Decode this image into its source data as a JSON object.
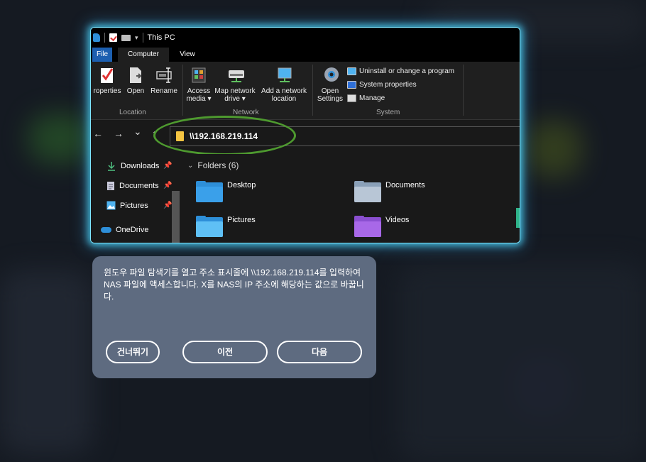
{
  "window": {
    "title": "This PC",
    "tabs": [
      "File",
      "Computer",
      "View"
    ],
    "ribbon": {
      "location": {
        "label": "Location",
        "buttons": [
          "roperties",
          "Open",
          "Rename"
        ]
      },
      "network": {
        "label": "Network",
        "buttons": [
          {
            "line1": "Access",
            "line2": "media ▾"
          },
          {
            "line1": "Map network",
            "line2": "drive ▾"
          },
          {
            "line1": "Add a network",
            "line2": "location"
          }
        ]
      },
      "system": {
        "label": "System",
        "open_settings_line1": "Open",
        "open_settings_line2": "Settings",
        "items": [
          "Uninstall or change a program",
          "System properties",
          "Manage"
        ]
      }
    },
    "nav": {
      "back": "←",
      "forward": "→",
      "recent": "⌄",
      "up": "↑"
    },
    "address": "\\\\192.168.219.114",
    "sidebar": {
      "items": [
        "Downloads",
        "Documents",
        "Pictures",
        "OneDrive"
      ]
    },
    "content": {
      "section": "Folders (6)",
      "folders": [
        "Desktop",
        "Documents",
        "Pictures",
        "Videos"
      ]
    }
  },
  "dialog": {
    "text": "윈도우 파일 탐색기를 열고 주소 표시줄에 \\\\192.168.219.114를 입력하여 NAS 파일에 액세스합니다. X를 NAS의 IP 주소에 해당하는 값으로 바꿉니다.",
    "skip_label": "건너뛰기",
    "prev_label": "이전",
    "next_label": "다음"
  },
  "colors": {
    "highlight_ring": "#4e9a2f",
    "window_glow": "#7fe6ff",
    "dialog_bg": "#5e6b80"
  }
}
